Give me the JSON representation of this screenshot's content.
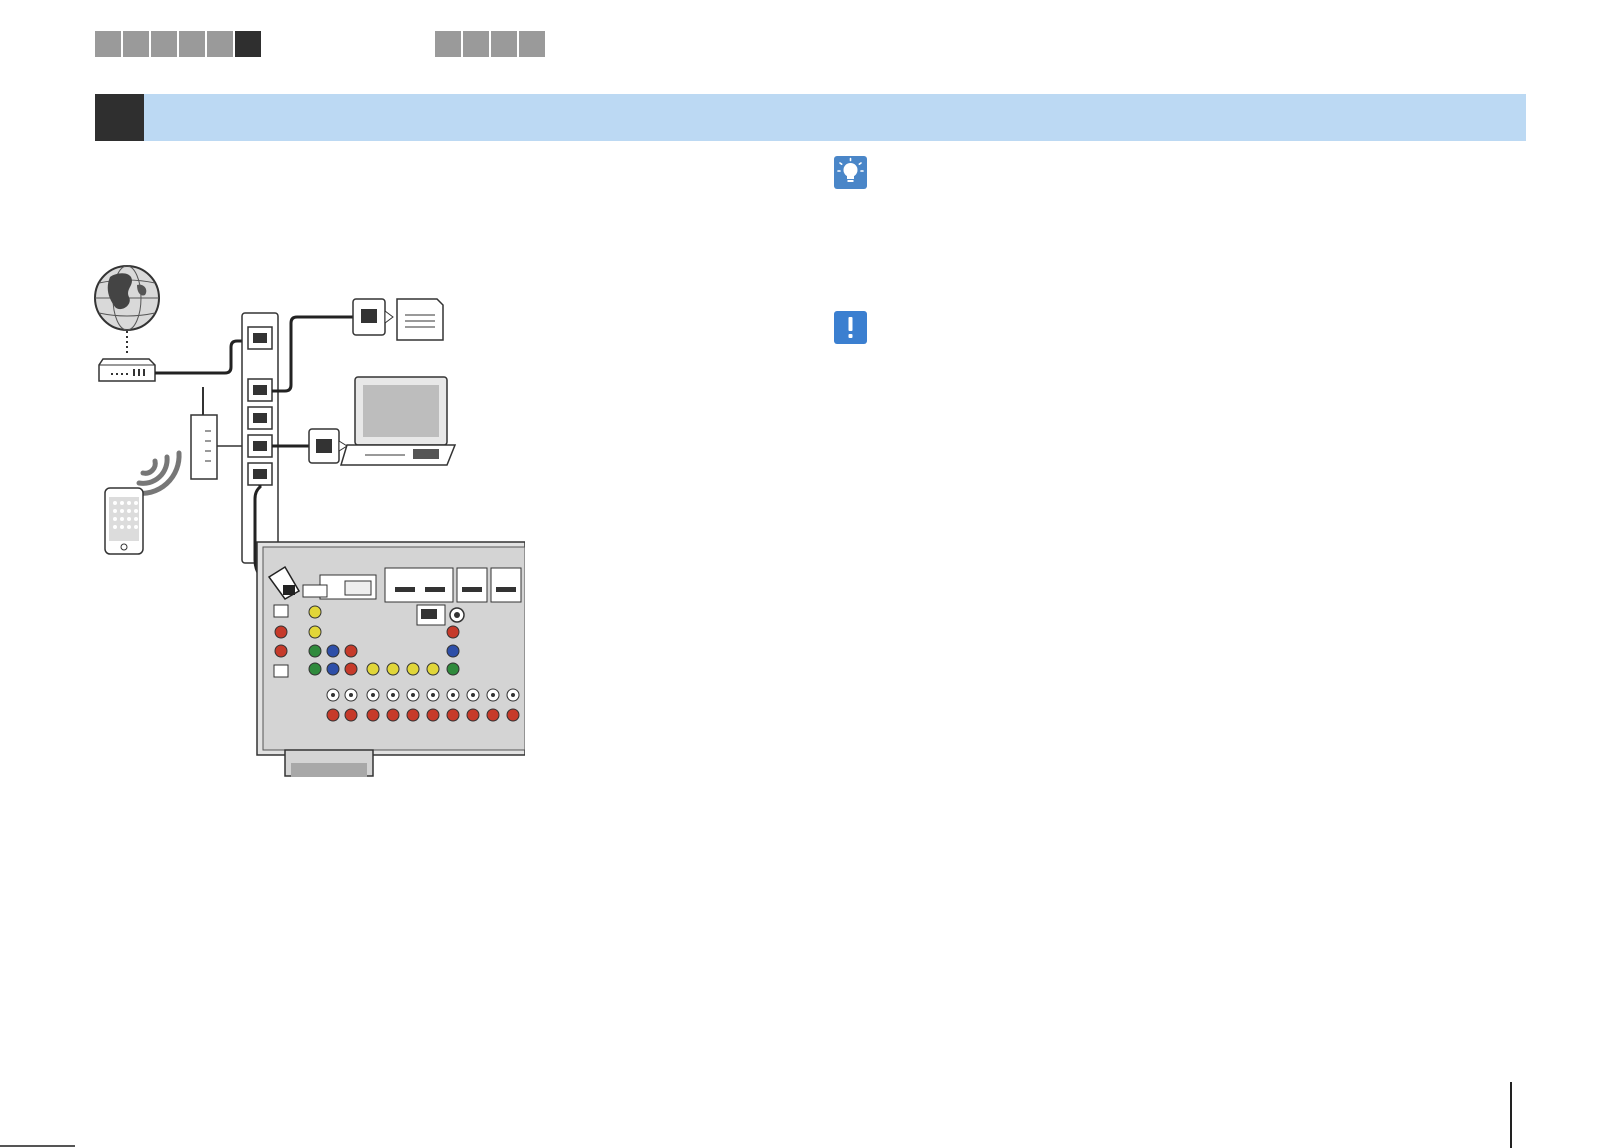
{
  "nav": {
    "group_a_count": 6,
    "group_a_active_index": 5,
    "group_b_count": 4
  },
  "section": {
    "bar_color": "#bcd9f3",
    "number_block_color": "#2f2f2f"
  },
  "callouts": {
    "tip_icon": "lightbulb-icon",
    "tip_color": "#4a86c8",
    "caution_icon": "exclamation-icon",
    "caution_color": "#3b7fd0"
  },
  "diagram": {
    "icons": [
      "globe-icon",
      "modem-icon",
      "network-switch-icon",
      "wireless-router-icon",
      "wifi-signal-icon",
      "smartphone-icon",
      "network-storage-icon",
      "laptop-icon",
      "av-receiver-rear-panel-icon",
      "network-cable-icon"
    ]
  }
}
